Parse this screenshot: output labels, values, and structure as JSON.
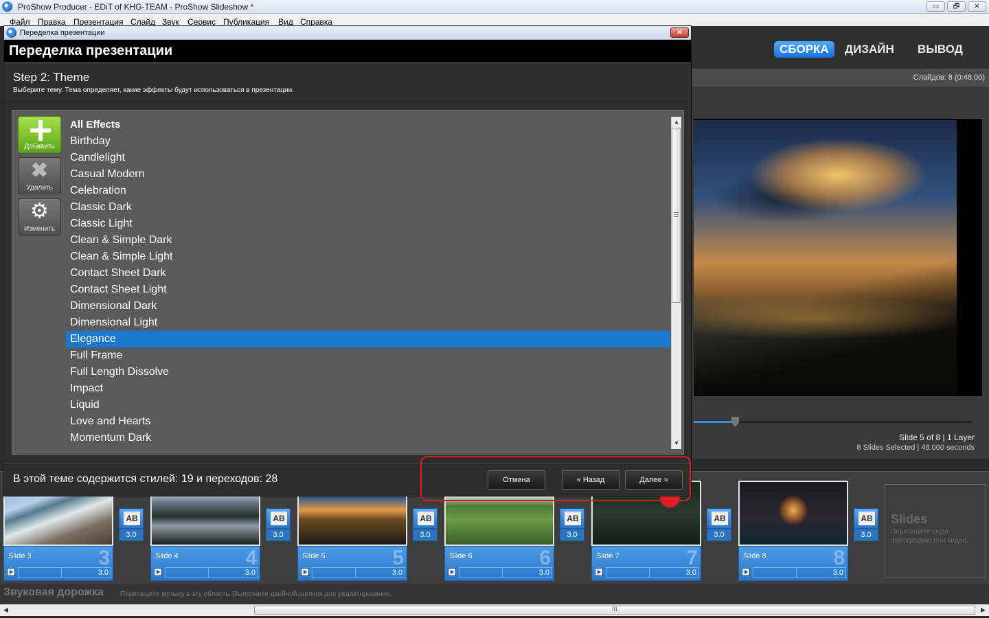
{
  "window": {
    "title": "ProShow Producer - EDiT of KHG-TEAM - ProShow Slideshow *",
    "controls": {
      "minimize": "▭",
      "maximize": "🗗",
      "close": "✕"
    }
  },
  "menu": {
    "items": [
      "Файл",
      "Правка",
      "Презентация",
      "Слайд",
      "Звук",
      "Сервис",
      "Публикация",
      "Вид",
      "Справка"
    ]
  },
  "app": {
    "mode_tabs": [
      {
        "label": "СБОРКА",
        "active": true
      },
      {
        "label": "ДИЗАЙН",
        "active": false
      },
      {
        "label": "ВЫВОД",
        "active": false
      }
    ],
    "slides_count": "Слайдов: 8 (0:48.00)",
    "preview_status": {
      "line1": "Slide 5 of 8  |  1 Layer",
      "line2": "8 Slides Selected  |  48.000 seconds"
    },
    "timeline_progress": 0.15,
    "slides": [
      {
        "name": "Slide 3",
        "number": "3",
        "time": "3.0",
        "transition_time": "3.0"
      },
      {
        "name": "Slide 4",
        "number": "4",
        "time": "3.0",
        "transition_time": "3.0"
      },
      {
        "name": "Slide 5",
        "number": "5",
        "time": "3.0",
        "transition_time": "3.0"
      },
      {
        "name": "Slide 6",
        "number": "6",
        "time": "3.0",
        "transition_time": "3.0"
      },
      {
        "name": "Slide 7",
        "number": "7",
        "time": "3.0",
        "transition_time": "3.0"
      },
      {
        "name": "Slide 8",
        "number": "8",
        "time": "3.0",
        "transition_time": "3.0"
      }
    ],
    "transition_icon_text": "AB",
    "slides_drop": {
      "title": "Slides",
      "hint": "Перетащите сюда фотографию или видео."
    },
    "audio_track": {
      "label": "Звуковая дорожка",
      "hint": "Перетащите музыку в эту область. Выполните двойной щелчок для редактирования."
    },
    "h_scroll_grip": "III"
  },
  "dialog": {
    "title": "Переделка презентации",
    "heading": "Переделка презентации",
    "close": "✕",
    "step_title": "Step 2: Theme",
    "step_description": "Выберите тему. Тема определяет, какие эффекты будут использоваться в презентации.",
    "tools": {
      "add": "Добавить",
      "delete": "Удалить",
      "edit": "Изменить"
    },
    "themes": [
      "All Effects",
      "Birthday",
      "Candlelight",
      "Casual Modern",
      "Celebration",
      "Classic Dark",
      "Classic Light",
      "Clean & Simple Dark",
      "Clean & Simple Light",
      "Contact Sheet Dark",
      "Contact Sheet Light",
      "Dimensional Dark",
      "Dimensional Light",
      "Elegance",
      "Full Frame",
      "Full Length Dissolve",
      "Impact",
      "Liquid",
      "Love and Hearts",
      "Momentum Dark"
    ],
    "selected_theme": "Elegance",
    "footer_info": "В этой теме содержится стилей: 19 и переходов: 28",
    "buttons": {
      "cancel": "Отмена",
      "back": "« Назад",
      "next": "Далее »"
    }
  },
  "colors": {
    "accent": "#1a79cf",
    "highlight": "#e01919",
    "add_green": "#5ea61a"
  }
}
